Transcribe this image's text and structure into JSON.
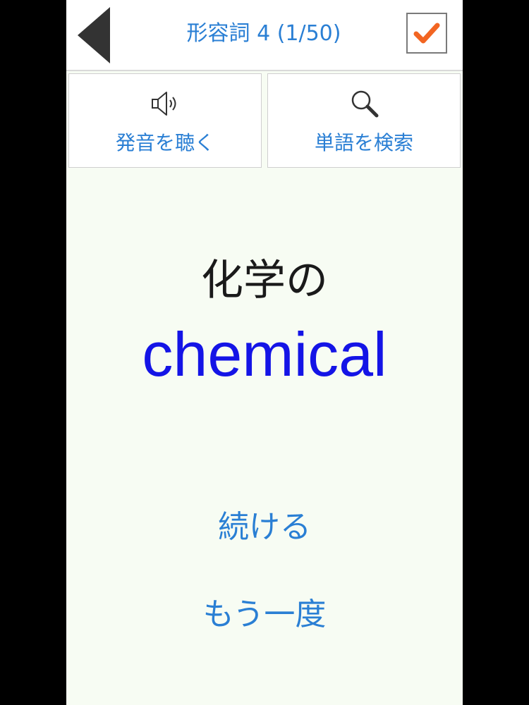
{
  "header": {
    "title": "形容詞 4 (1/50)",
    "back_icon": "back-triangle-icon",
    "check_icon": "checkmark-icon",
    "check_color": "#f26522"
  },
  "actions": {
    "listen_label": "発音を聴く",
    "listen_icon": "speaker-icon",
    "search_label": "単語を検索",
    "search_icon": "magnifier-icon"
  },
  "card": {
    "meaning": "化学の",
    "word": "chemical"
  },
  "controls": {
    "continue_label": "続ける",
    "again_label": "もう一度"
  },
  "colors": {
    "accent": "#2a7fd4",
    "word": "#1414e6",
    "background": "#f7fcf3"
  }
}
